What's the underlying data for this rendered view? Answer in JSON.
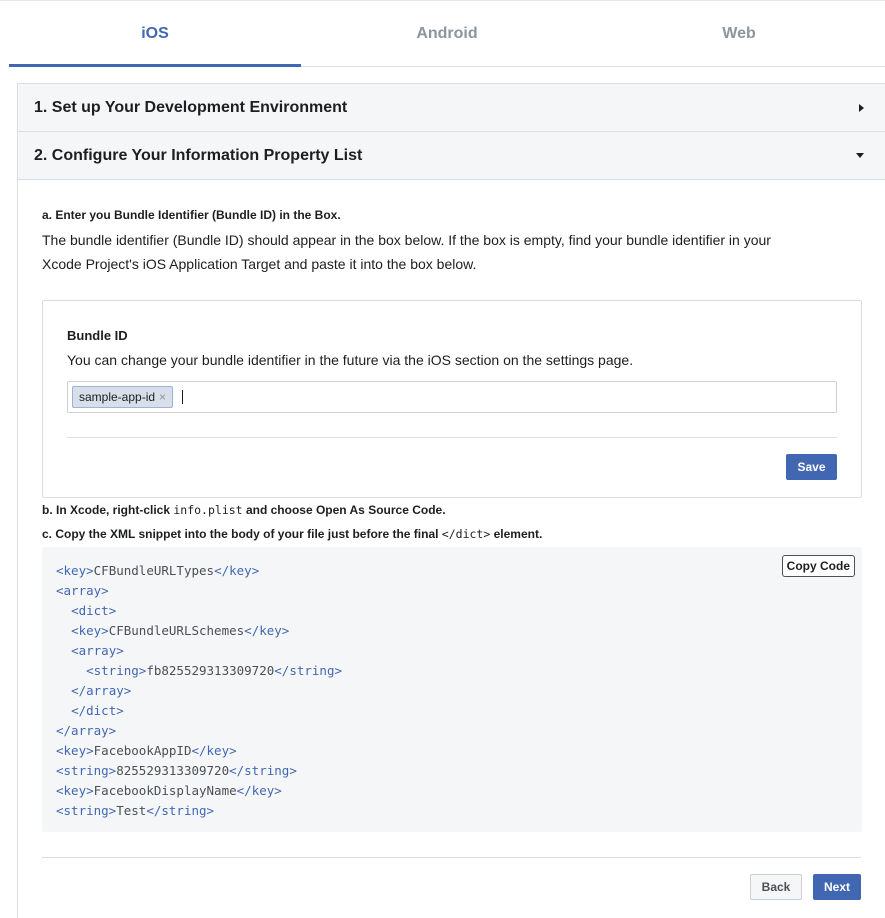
{
  "tabs": [
    {
      "label": "iOS",
      "active": true
    },
    {
      "label": "Android",
      "active": false
    },
    {
      "label": "Web",
      "active": false
    }
  ],
  "steps": {
    "step1_title": "1. Set up Your Development Environment",
    "step2_title": "2. Configure Your Information Property List"
  },
  "step2": {
    "a_label": "a. Enter you Bundle Identifier (Bundle ID) in the Box.",
    "a_line1": "The bundle identifier (Bundle ID) should appear in the box below. If the box is empty, find your bundle identifier in your",
    "a_line2": "Xcode Project's iOS Application Target and paste it into the box below.",
    "bundle": {
      "title": "Bundle ID",
      "help": "You can change your bundle identifier in the future via the iOS section on the settings page.",
      "token": "sample-app-id",
      "token_remove": "×",
      "save_label": "Save"
    },
    "b_prefix": "b. In Xcode, right-click ",
    "b_code": "info.plist",
    "b_suffix": " and choose Open As Source Code.",
    "c_prefix": "c. Copy the XML snippet into the body of your file just before the final ",
    "c_code": "</dict>",
    "c_suffix": " element.",
    "copy_label": "Copy Code",
    "code_lines": [
      {
        "indent": "",
        "open": "<key>",
        "text": "CFBundleURLTypes",
        "close": "</key>"
      },
      {
        "indent": "",
        "open": "<array>",
        "text": "",
        "close": ""
      },
      {
        "indent": "  ",
        "open": "<dict>",
        "text": "",
        "close": ""
      },
      {
        "indent": "  ",
        "open": "<key>",
        "text": "CFBundleURLSchemes",
        "close": "</key>"
      },
      {
        "indent": "  ",
        "open": "<array>",
        "text": "",
        "close": ""
      },
      {
        "indent": "    ",
        "open": "<string>",
        "text": "fb825529313309720",
        "close": "</string>"
      },
      {
        "indent": "  ",
        "open": "</array>",
        "text": "",
        "close": ""
      },
      {
        "indent": "  ",
        "open": "</dict>",
        "text": "",
        "close": ""
      },
      {
        "indent": "",
        "open": "</array>",
        "text": "",
        "close": ""
      },
      {
        "indent": "",
        "open": "<key>",
        "text": "FacebookAppID",
        "close": "</key>"
      },
      {
        "indent": "",
        "open": "<string>",
        "text": "825529313309720",
        "close": "</string>"
      },
      {
        "indent": "",
        "open": "<key>",
        "text": "FacebookDisplayName",
        "close": "</key>"
      },
      {
        "indent": "",
        "open": "<string>",
        "text": "Test",
        "close": "</string>"
      }
    ]
  },
  "footer": {
    "back_label": "Back",
    "next_label": "Next"
  },
  "colors": {
    "accent": "#4267b2",
    "panel_bg": "#f5f6f7",
    "border": "#dadde1"
  }
}
